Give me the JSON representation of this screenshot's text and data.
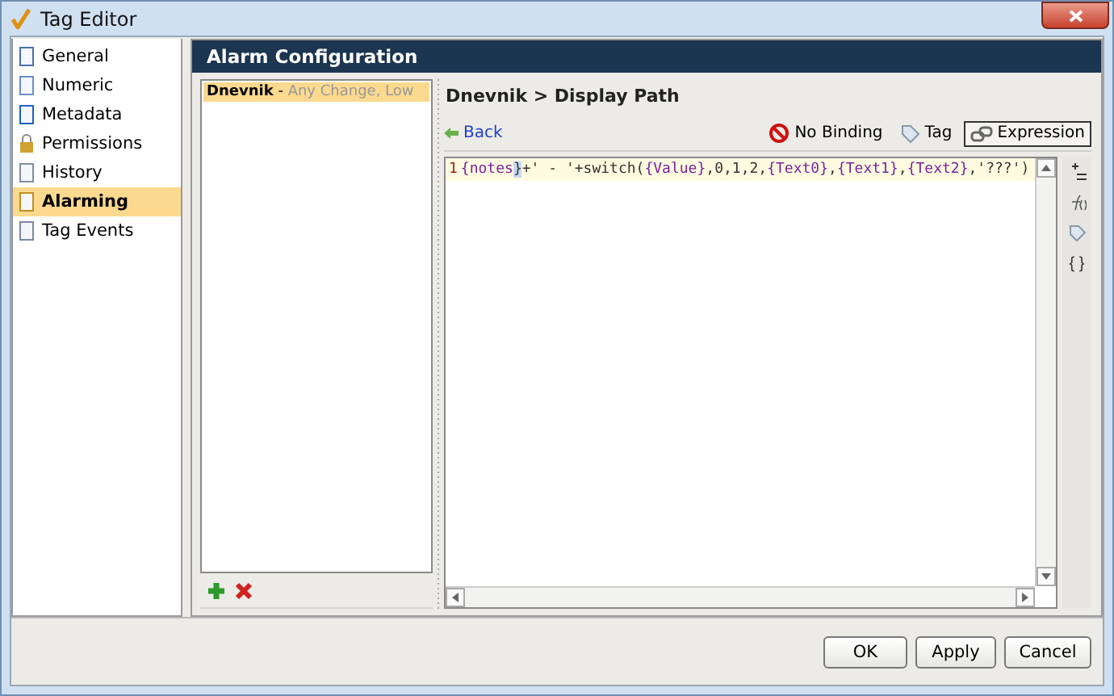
{
  "window": {
    "title": "Tag Editor"
  },
  "sidebar": {
    "items": [
      {
        "label": "General",
        "kind": "general",
        "selected": false
      },
      {
        "label": "Numeric",
        "kind": "numeric",
        "selected": false
      },
      {
        "label": "Metadata",
        "kind": "metadata",
        "selected": false
      },
      {
        "label": "Permissions",
        "kind": "permissions",
        "selected": false
      },
      {
        "label": "History",
        "kind": "history",
        "selected": false
      },
      {
        "label": "Alarming",
        "kind": "alarming",
        "selected": true
      },
      {
        "label": "Tag Events",
        "kind": "events",
        "selected": false
      }
    ]
  },
  "panel": {
    "title": "Alarm Configuration"
  },
  "alarms": [
    {
      "name": "Dnevnik",
      "separator": " - ",
      "detail": "Any Change, Low",
      "selected": true
    }
  ],
  "editor": {
    "breadcrumb": "Dnevnik > Display Path",
    "back": "Back",
    "modes": [
      {
        "label": "No Binding",
        "kind": "none",
        "selected": false
      },
      {
        "label": "Tag",
        "kind": "tag",
        "selected": false
      },
      {
        "label": "Expression",
        "kind": "expression",
        "selected": true
      }
    ],
    "line_number": "1",
    "tokens": [
      {
        "text": "{notes",
        "kind": "ref"
      },
      {
        "text": "}",
        "kind": "cursor"
      },
      {
        "text": "+' - '+switch(",
        "kind": "code"
      },
      {
        "text": "{Value}",
        "kind": "ref"
      },
      {
        "text": ",0,1,2,",
        "kind": "code"
      },
      {
        "text": "{Text0}",
        "kind": "ref"
      },
      {
        "text": ",",
        "kind": "code"
      },
      {
        "text": "{Text1}",
        "kind": "ref"
      },
      {
        "text": ",",
        "kind": "code"
      },
      {
        "text": "{Text2}",
        "kind": "ref"
      },
      {
        "text": ",'???')",
        "kind": "code"
      }
    ],
    "tools": [
      {
        "kind": "operator"
      },
      {
        "kind": "function"
      },
      {
        "kind": "tag"
      },
      {
        "kind": "braces",
        "text": "{ }"
      }
    ]
  },
  "buttons": [
    "OK",
    "Apply",
    "Cancel"
  ]
}
